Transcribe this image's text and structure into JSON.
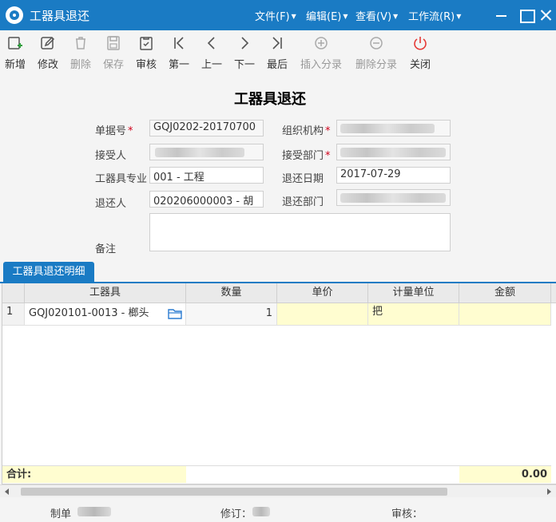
{
  "window": {
    "title": "工器具退还",
    "menus": [
      "文件(F)",
      "编辑(E)",
      "查看(V)",
      "工作流(R)"
    ]
  },
  "toolbar": {
    "new": "新增",
    "edit": "修改",
    "delete": "删除",
    "save": "保存",
    "audit": "审核",
    "first": "第一",
    "prev": "上一",
    "next": "下一",
    "last": "最后",
    "insert_entry": "插入分录",
    "delete_entry": "删除分录",
    "close": "关闭"
  },
  "form": {
    "title": "工器具退还",
    "doc_no_label": "单据号",
    "doc_no": "GQJ0202-20170700",
    "org_label": "组织机构",
    "receiver_label": "接受人",
    "receive_dept_label": "接受部门",
    "specialty_label": "工器具专业",
    "specialty": "001 - 工程",
    "return_date_label": "退还日期",
    "return_date": "2017-07-29",
    "returner_label": "退还人",
    "returner": "020206000003 - 胡",
    "return_dept_label": "退还部门",
    "remark_label": "备注",
    "remark": "",
    "required_mark": "*"
  },
  "detail": {
    "tab_label": "工器具退还明细",
    "columns": [
      "工器具",
      "数量",
      "单价",
      "计量单位",
      "金额"
    ],
    "rows": [
      {
        "no": "1",
        "tool": "GQJ020101-0013 - 榔头",
        "qty": "1",
        "price": "",
        "unit": "把",
        "amount": ""
      }
    ],
    "total_label": "合计:",
    "total_amount": "0.00"
  },
  "footer": {
    "maker_label": "制单",
    "reviser_label": "修订：",
    "auditor_label": "审核："
  },
  "colors": {
    "accent": "#1a7bc4",
    "required": "#d0021b",
    "editable_cell": "#fffdd0",
    "close_icon": "#e53935"
  }
}
